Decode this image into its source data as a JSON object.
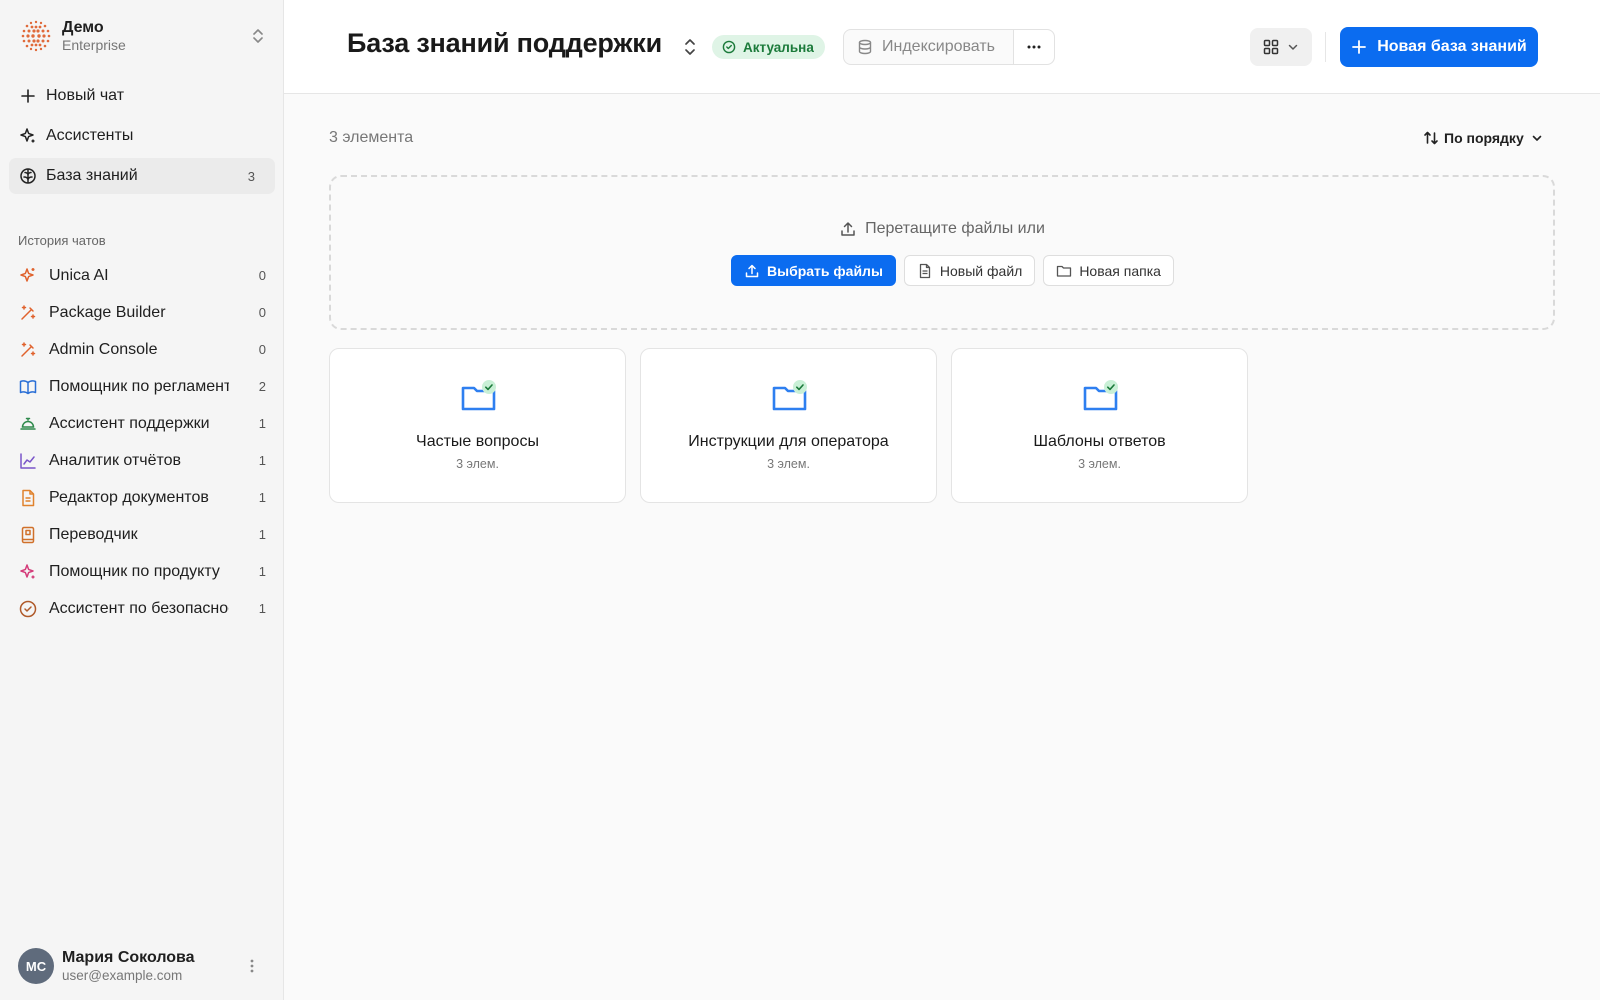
{
  "workspace": {
    "name": "Демо",
    "plan": "Enterprise"
  },
  "nav": [
    {
      "label": "Новый чат",
      "icon": "plus-icon",
      "count": null
    },
    {
      "label": "Ассистенты",
      "icon": "sparkle-icon",
      "count": null
    },
    {
      "label": "База знаний",
      "icon": "brain-icon",
      "count": "3",
      "active": true
    }
  ],
  "history": {
    "title": "История чатов",
    "items": [
      {
        "label": "Unica AI",
        "count": "0",
        "icon": "sparkles-icon",
        "color": "#e0622d"
      },
      {
        "label": "Package Builder",
        "count": "0",
        "icon": "wand-icon",
        "color": "#e0622d"
      },
      {
        "label": "Admin Console",
        "count": "0",
        "icon": "wand-icon",
        "color": "#e0622d"
      },
      {
        "label": "Помощник по регламентам",
        "count": "2",
        "icon": "book-icon",
        "color": "#2a6fd6"
      },
      {
        "label": "Ассистент поддержки",
        "count": "1",
        "icon": "bell-icon",
        "color": "#2f8a4c"
      },
      {
        "label": "Аналитик отчётов",
        "count": "1",
        "icon": "chart-icon",
        "color": "#7a55c9"
      },
      {
        "label": "Редактор документов",
        "count": "1",
        "icon": "document-icon",
        "color": "#e0822d"
      },
      {
        "label": "Переводчик",
        "count": "1",
        "icon": "dictionary-icon",
        "color": "#d0702a"
      },
      {
        "label": "Помощник по продукту",
        "count": "1",
        "icon": "sparkle-icon",
        "color": "#d43c7a"
      },
      {
        "label": "Ассистент по безопасности",
        "count": "1",
        "icon": "check-circle-icon",
        "color": "#b05a2a"
      }
    ]
  },
  "user": {
    "initials": "МС",
    "name": "Мария Соколова",
    "email": "user@example.com"
  },
  "header": {
    "title": "База знаний поддержки",
    "status": "Актуальна",
    "index_label": "Индексировать",
    "new_kb_label": "Новая база знаний"
  },
  "content": {
    "count_label": "3 элемента",
    "sort_label": "По порядку",
    "dropzone": {
      "hint": "Перетащите файлы или",
      "choose_label": "Выбрать файлы",
      "new_file_label": "Новый файл",
      "new_folder_label": "Новая папка"
    },
    "folders": [
      {
        "title": "Частые вопросы",
        "subtitle": "3 элем."
      },
      {
        "title": "Инструкции для оператора",
        "subtitle": "3 элем."
      },
      {
        "title": "Шаблоны ответов",
        "subtitle": "3 элем."
      }
    ]
  },
  "colors": {
    "accent": "#0b6cf0",
    "status_bg": "#dff4e6",
    "status_text": "#1b7a3a",
    "folder": "#2e7ff0"
  }
}
